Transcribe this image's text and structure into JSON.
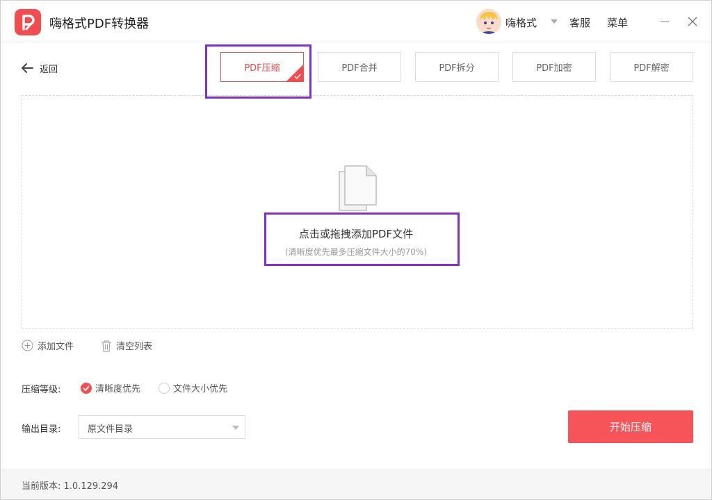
{
  "app": {
    "title": "嗨格式PDF转换器",
    "brand_color": "#f24c4f"
  },
  "header": {
    "username": "嗨格式",
    "service_label": "客服",
    "menu_label": "菜单"
  },
  "toolbar": {
    "back_label": "返回",
    "tabs": [
      {
        "label": "PDF压缩",
        "active": true
      },
      {
        "label": "PDF合并",
        "active": false
      },
      {
        "label": "PDF拆分",
        "active": false
      },
      {
        "label": "PDF加密",
        "active": false
      },
      {
        "label": "PDF解密",
        "active": false
      }
    ]
  },
  "dropzone": {
    "title": "点击或拖拽添加PDF文件",
    "subtitle": "(清晰度优先最多压缩文件大小的70%)"
  },
  "file_actions": {
    "add_label": "添加文件",
    "clear_label": "清空列表"
  },
  "options": {
    "level_label": "压缩等级:",
    "level_options": [
      {
        "label": "清晰度优先",
        "selected": true
      },
      {
        "label": "文件大小优先",
        "selected": false
      }
    ],
    "output_label": "输出目录:",
    "output_value": "原文件目录"
  },
  "actions": {
    "start_label": "开始压缩"
  },
  "footer": {
    "version_label": "当前版本: 1.0.129.294"
  },
  "icons": {
    "logo": "pdf-logo-icon",
    "back": "arrow-left-icon",
    "minimize": "minimize-icon",
    "close": "close-icon",
    "document": "document-icon",
    "add": "plus-circle-icon",
    "clear": "trash-icon",
    "check": "check-icon"
  }
}
